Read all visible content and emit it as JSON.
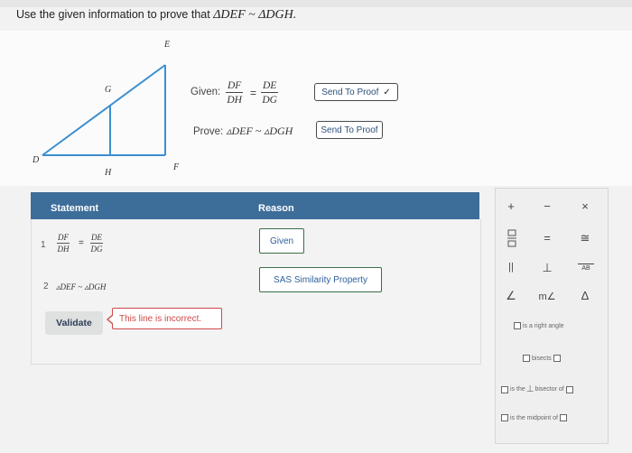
{
  "prompt": {
    "text": "Use the given information to prove that",
    "math": "ΔDEF ~ ΔDGH."
  },
  "figure": {
    "labels": {
      "E": "E",
      "G": "G",
      "D": "D",
      "H": "H",
      "F": "F"
    }
  },
  "given": {
    "label": "Given:",
    "frac1": {
      "num": "DF",
      "den": "DH"
    },
    "equals": "=",
    "frac2": {
      "num": "DE",
      "den": "DG"
    },
    "button_label": "Send To Proof",
    "button_check": "✓"
  },
  "prove": {
    "label": "Prove:",
    "statement": "▵DEF ~ ▵DGH",
    "button_label": "Send To Proof"
  },
  "table": {
    "header_statement": "Statement",
    "header_reason": "Reason",
    "rows": [
      {
        "num": "1",
        "frac1": {
          "num": "DF",
          "den": "DH"
        },
        "equals": "=",
        "frac2": {
          "num": "DE",
          "den": "DG"
        },
        "reason": "Given"
      },
      {
        "num": "2",
        "statement": "▵DEF ~ ▵DGH",
        "reason": "SAS Similarity Property"
      }
    ],
    "validate_label": "Validate",
    "feedback": "This line is incorrect."
  },
  "palette": {
    "plus": "+",
    "minus": "−",
    "times": "×",
    "fraction_icon": "fraction-icon",
    "equals": "=",
    "congruent": "≅",
    "parallel": "||",
    "perpendicular": "⊥",
    "segment": "AB",
    "angle": "∠",
    "measure_angle": "m∠",
    "triangle": "Δ",
    "right_angle_text": "is a right angle",
    "bisects_text": "bisects",
    "perp_bisector_text_1": "is the",
    "perp_bisector_symbol": "⊥",
    "perp_bisector_text_2": "bisector of",
    "midpoint_text": "is the midpoint of"
  }
}
